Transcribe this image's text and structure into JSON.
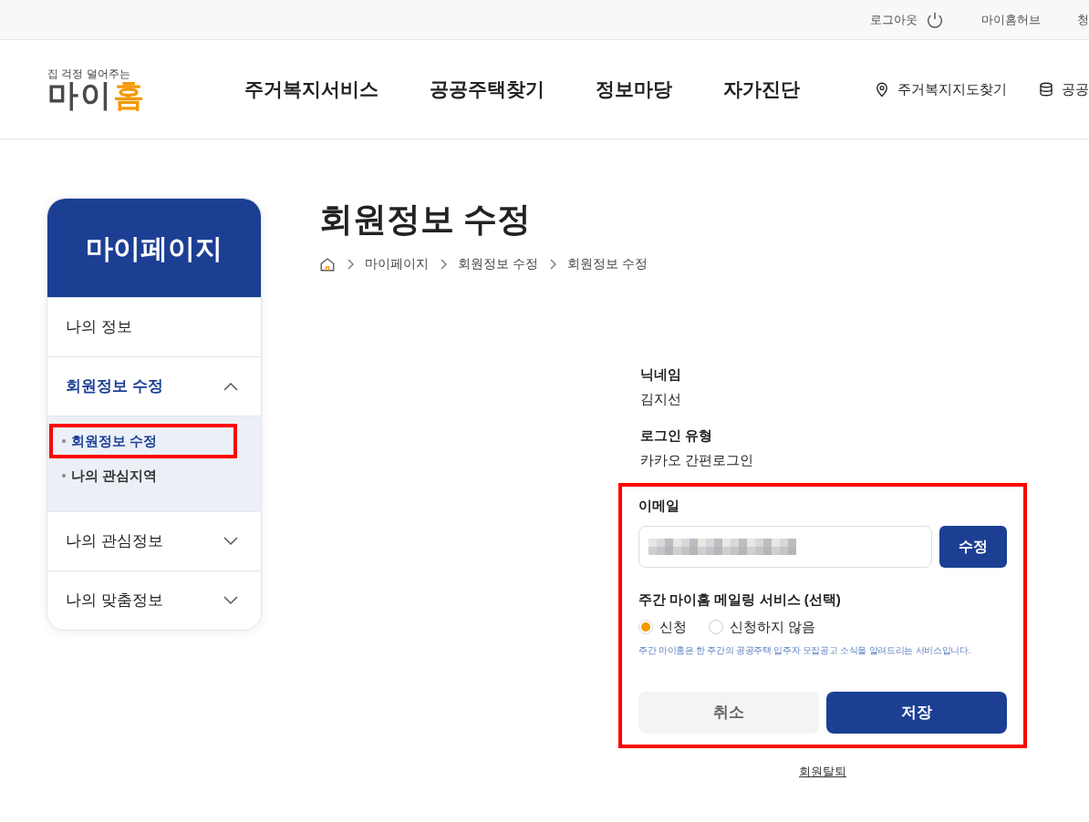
{
  "top_bar": {
    "links": [
      {
        "label": "로그아웃",
        "kind": "logout"
      },
      {
        "label": "마이홈허브",
        "kind": "plain"
      },
      {
        "label": "청",
        "kind": "plain"
      }
    ]
  },
  "logo": {
    "tagline": "집 걱정 덜어주는",
    "name_main": "마이",
    "name_accent": "홈"
  },
  "nav": {
    "items": [
      "주거복지서비스",
      "공공주택찾기",
      "정보마당",
      "자가진단"
    ],
    "quick_links": [
      {
        "label": "주거복지지도찾기",
        "kind": "map"
      },
      {
        "label": "공공",
        "kind": "database"
      }
    ]
  },
  "sidebar": {
    "title": "마이페이지",
    "items": [
      {
        "label": "나의 정보",
        "selected": false
      },
      {
        "label": "회원정보 수정",
        "selected": true,
        "expanded": true,
        "children": [
          {
            "label": "회원정보 수정",
            "selected": true,
            "highlighted": true
          },
          {
            "label": "나의 관심지역",
            "selected": false,
            "highlighted": false
          }
        ]
      },
      {
        "label": "나의 관심정보",
        "selected": false,
        "expanded": false
      },
      {
        "label": "나의 맞춤정보",
        "selected": false,
        "expanded": false
      }
    ]
  },
  "page": {
    "title": "회원정보 수정",
    "breadcrumb": [
      "마이페이지",
      "회원정보 수정",
      "회원정보 수정"
    ]
  },
  "form": {
    "fields": [
      {
        "label": "닉네임",
        "value": "김지선"
      },
      {
        "label": "로그인 유형",
        "value": "카카오 간편로그인"
      }
    ],
    "email": {
      "label": "이메일",
      "redacted": true,
      "button": "수정"
    },
    "mailing": {
      "label": "주간 마이홈 메일링 서비스 (선택)",
      "options": [
        {
          "label": "신청",
          "selected": true
        },
        {
          "label": "신청하지 않음",
          "selected": false
        }
      ],
      "hint": "주간 마이홈은 한 주간의 공공주택 입주자 모집공고 소식을 알려드리는 서비스입니다."
    },
    "highlighted": true,
    "buttons": [
      {
        "label": "취소",
        "kind": "secondary"
      },
      {
        "label": "저장",
        "kind": "primary"
      }
    ],
    "withdraw_link": "회원탈퇴"
  }
}
